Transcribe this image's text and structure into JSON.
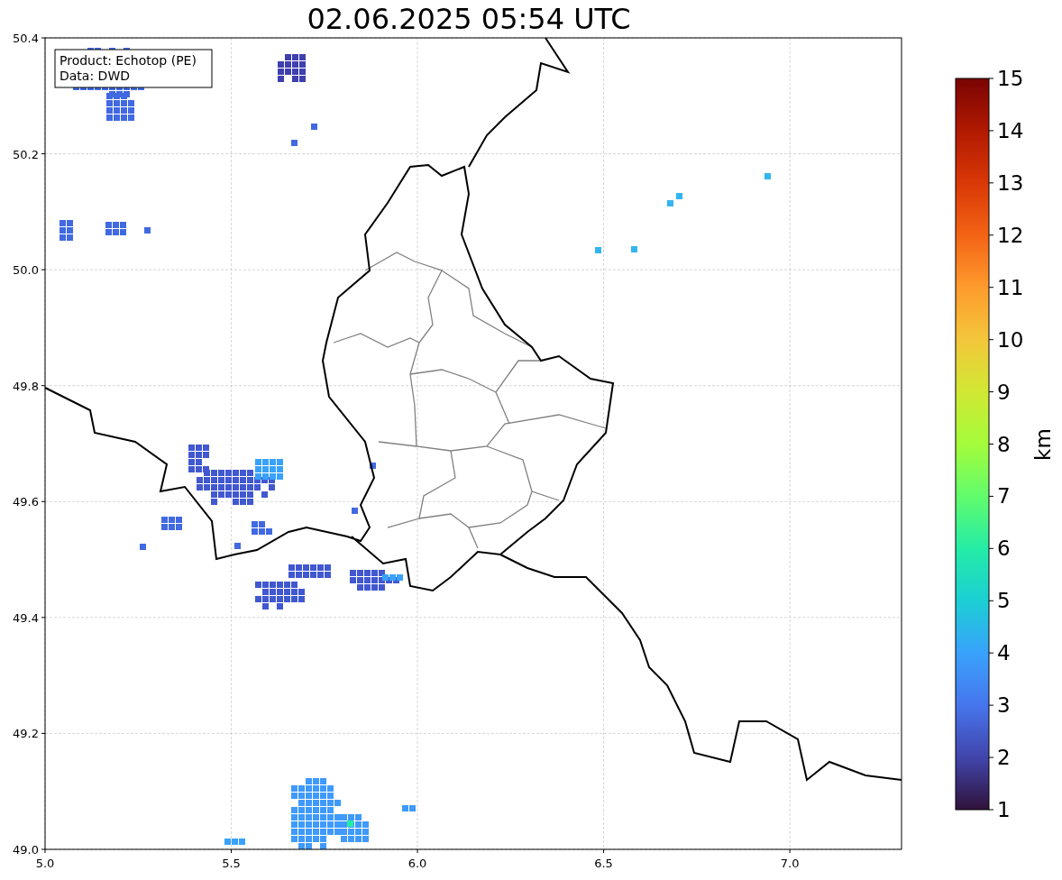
{
  "title": "02.06.2025 05:54 UTC",
  "info_box": [
    "Product: Echotop (PE)",
    "Data: DWD"
  ],
  "map": {
    "x_ticks": [
      "5.0",
      "5.5",
      "6.0",
      "6.5",
      "7.0"
    ],
    "y_ticks": [
      "50.4",
      "50.2",
      "50.0",
      "49.8",
      "49.6",
      "49.4",
      "49.2",
      "49.0"
    ]
  },
  "colorbar": {
    "label": "km",
    "ticks": [
      "15",
      "14",
      "13",
      "12",
      "11",
      "10",
      "9",
      "8",
      "7",
      "6",
      "5",
      "4",
      "3",
      "2",
      "1"
    ]
  }
}
